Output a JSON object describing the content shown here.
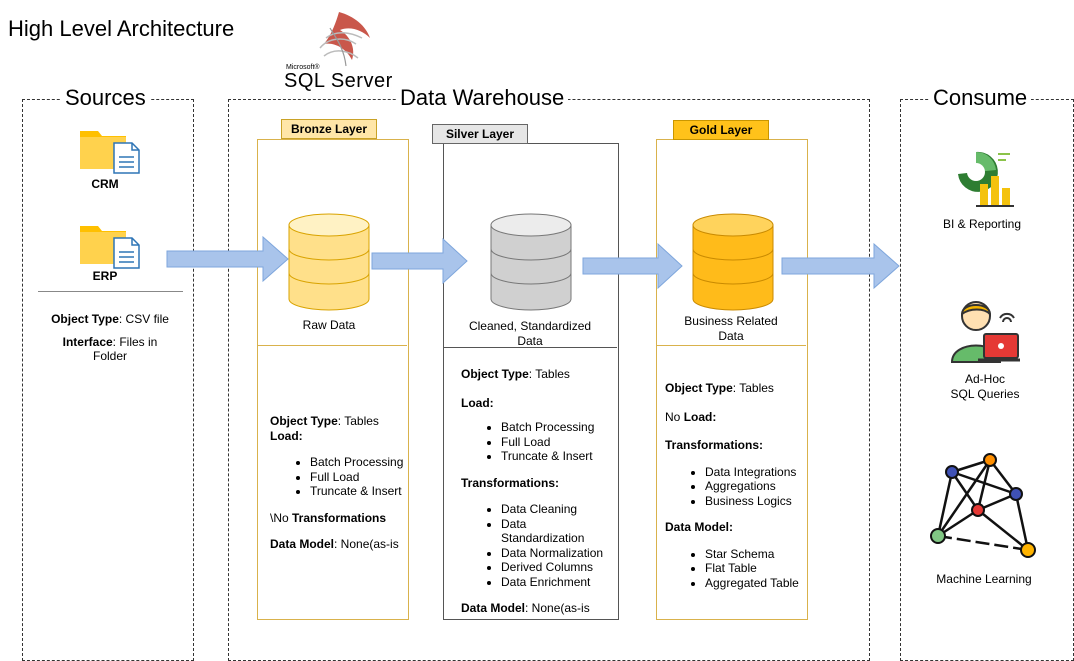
{
  "page_title": "High Level Architecture",
  "logo": {
    "vendor": "Microsoft®",
    "product": "SQL Server"
  },
  "sources": {
    "title": "Sources",
    "items": [
      {
        "label": "CRM",
        "icon": "folder-file-icon"
      },
      {
        "label": "ERP",
        "icon": "folder-file-icon"
      }
    ],
    "object_type_key": "Object Type",
    "object_type_value": ": CSV file",
    "interface_key": "Interface",
    "interface_value_1": ": Files in",
    "interface_value_2": "Folder"
  },
  "warehouse": {
    "title": "Data Warehouse",
    "bronze": {
      "tag": "Bronze Layer",
      "db_label": "Raw Data",
      "object_type_key": "Object Type",
      "object_type_value": ": Tables",
      "load_key": "Load:",
      "load_items": [
        "Batch Processing",
        "Full Load",
        "Truncate & Insert"
      ],
      "transform_prefix": "\\No ",
      "transform_key": "Transformations",
      "model_key": "Data Model",
      "model_value": ": None(as-is"
    },
    "silver": {
      "tag": "Silver Layer",
      "db_label_1": "Cleaned, Standardized",
      "db_label_2": "Data",
      "object_type_key": "Object Type",
      "object_type_value": ": Tables",
      "load_key": "Load:",
      "load_items": [
        "Batch Processing",
        "Full Load",
        "Truncate & Insert"
      ],
      "transform_key": "Transformations:",
      "transform_items": [
        "Data Cleaning",
        "Data Standardization",
        "Data Normalization",
        "Derived Columns",
        "Data Enrichment"
      ],
      "model_key": "Data Model",
      "model_value": ": None(as-is"
    },
    "gold": {
      "tag": "Gold Layer",
      "db_label_1": "Business Related",
      "db_label_2": "Data",
      "object_type_key": "Object Type",
      "object_type_value": ": Tables",
      "load_value": "No ",
      "load_key": "Load:",
      "transform_key": "Transformations:",
      "transform_items": [
        "Data Integrations",
        "Aggregations",
        "Business Logics"
      ],
      "model_key": "Data Model:",
      "model_items": [
        "Star Schema",
        "Flat Table",
        "Aggregated Table"
      ]
    }
  },
  "consume": {
    "title": "Consume",
    "items": [
      {
        "label": "BI & Reporting",
        "icon": "bi-chart-icon"
      },
      {
        "label_1": "Ad-Hoc",
        "label_2": "SQL Queries",
        "icon": "analyst-laptop-icon"
      },
      {
        "label": "Machine Learning",
        "icon": "network-graph-icon"
      }
    ]
  },
  "colors": {
    "bronze_db": "#ffd966",
    "silver_db": "#bfbfbf",
    "gold_db": "#ffb000",
    "arrow": "#a9c4eb",
    "folder": "#ffc000"
  }
}
